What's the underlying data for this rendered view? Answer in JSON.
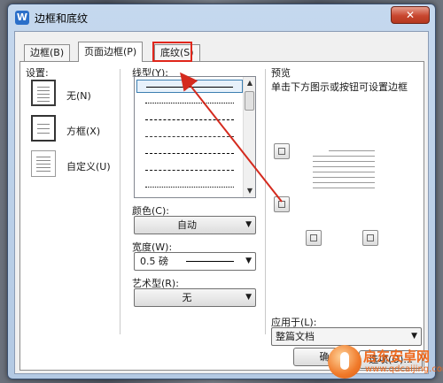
{
  "window": {
    "title": "边框和底纹",
    "app_icon": "W",
    "close_label": "✕"
  },
  "tabs": [
    {
      "label": "边框(B)"
    },
    {
      "label": "页面边框(P)"
    },
    {
      "label": "底纹(S)"
    }
  ],
  "settings": {
    "heading": "设置:",
    "options": [
      {
        "label": "无(N)"
      },
      {
        "label": "方框(X)"
      },
      {
        "label": "自定义(U)"
      }
    ]
  },
  "style": {
    "heading": "线型(Y):"
  },
  "color": {
    "heading": "颜色(C):",
    "value": "自动"
  },
  "width": {
    "heading": "宽度(W):",
    "value": "0.5 磅"
  },
  "art": {
    "heading": "艺术型(R):",
    "value": "无"
  },
  "preview": {
    "heading": "预览",
    "hint": "单击下方图示或按钮可设置边框",
    "apply_heading": "应用于(L):",
    "apply_value": "整篇文档",
    "options_button": "选项(O)..."
  },
  "footer": {
    "ok_partial": "确"
  },
  "watermark": {
    "brand": "启东安卓网",
    "url": "www.qdcaijing.com"
  },
  "colors": {
    "highlight": "#e0261b",
    "arrow": "#d42a1e",
    "accent": "#2b6fc9"
  }
}
